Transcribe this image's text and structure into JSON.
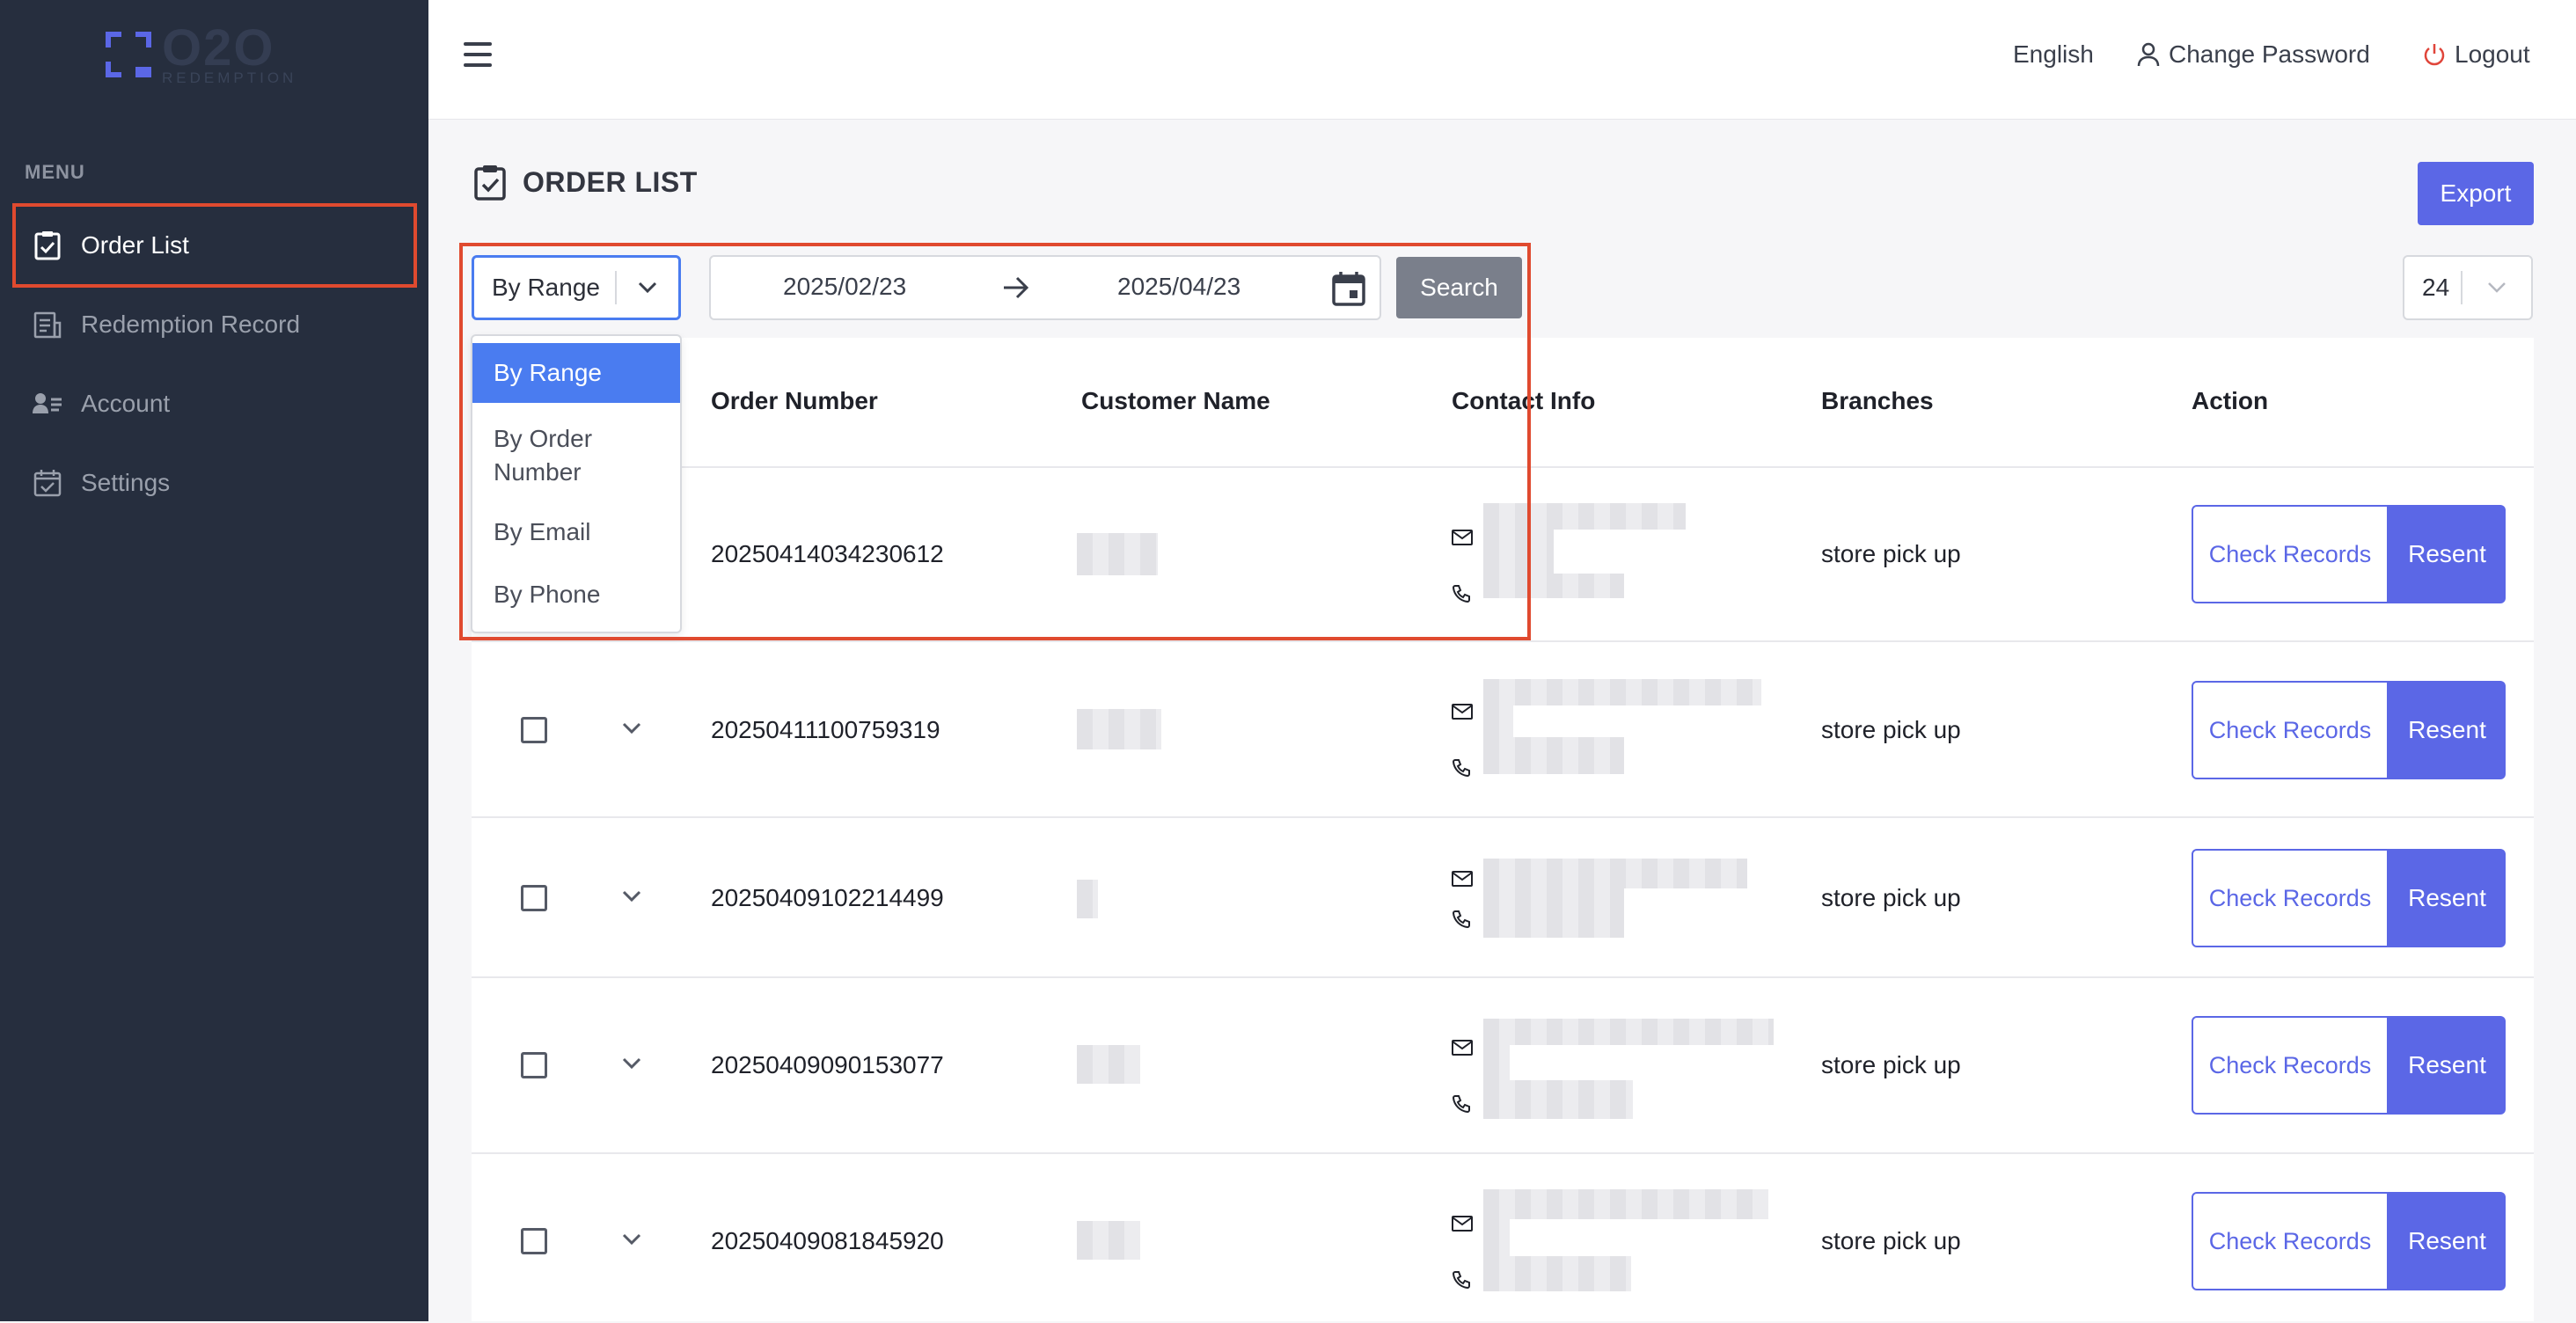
{
  "brand": {
    "name": "O2O",
    "tagline": "REDEMPTION",
    "accent_color": "#5b67e6"
  },
  "sidebar": {
    "menu_label": "MENU",
    "items": [
      {
        "label": "Order List",
        "icon": "clipboard-check-icon",
        "active": true
      },
      {
        "label": "Redemption Record",
        "icon": "receipt-icon",
        "active": false
      },
      {
        "label": "Account",
        "icon": "user-list-icon",
        "active": false
      },
      {
        "label": "Settings",
        "icon": "calendar-check-icon",
        "active": false
      }
    ]
  },
  "header": {
    "language": "English",
    "change_password": "Change Password",
    "logout": "Logout"
  },
  "page": {
    "title": "ORDER LIST",
    "export_label": "Export"
  },
  "filters": {
    "mode_selected": "By Range",
    "mode_options": [
      "By Range",
      "By Order Number",
      "By Email",
      "By Phone"
    ],
    "date_from": "2025/02/23",
    "date_to": "2025/04/23",
    "search_label": "Search",
    "page_size": "24"
  },
  "table": {
    "columns": [
      "Order Number",
      "Customer Name",
      "Contact Info",
      "Branches",
      "Action"
    ],
    "check_records_label": "Check Records",
    "resent_label": "Resent",
    "rows": [
      {
        "order_number": "20250414034230612",
        "branch": "store pick up"
      },
      {
        "order_number": "20250411100759319",
        "branch": "store pick up"
      },
      {
        "order_number": "20250409102214499",
        "branch": "store pick up"
      },
      {
        "order_number": "20250409090153077",
        "branch": "store pick up"
      },
      {
        "order_number": "20250409081845920",
        "branch": "store pick up"
      }
    ]
  },
  "colors": {
    "sidebar_bg": "#262e3e",
    "highlight": "#e04a2f",
    "select_blue": "#4a7cf0",
    "button": "#5b67e6"
  }
}
